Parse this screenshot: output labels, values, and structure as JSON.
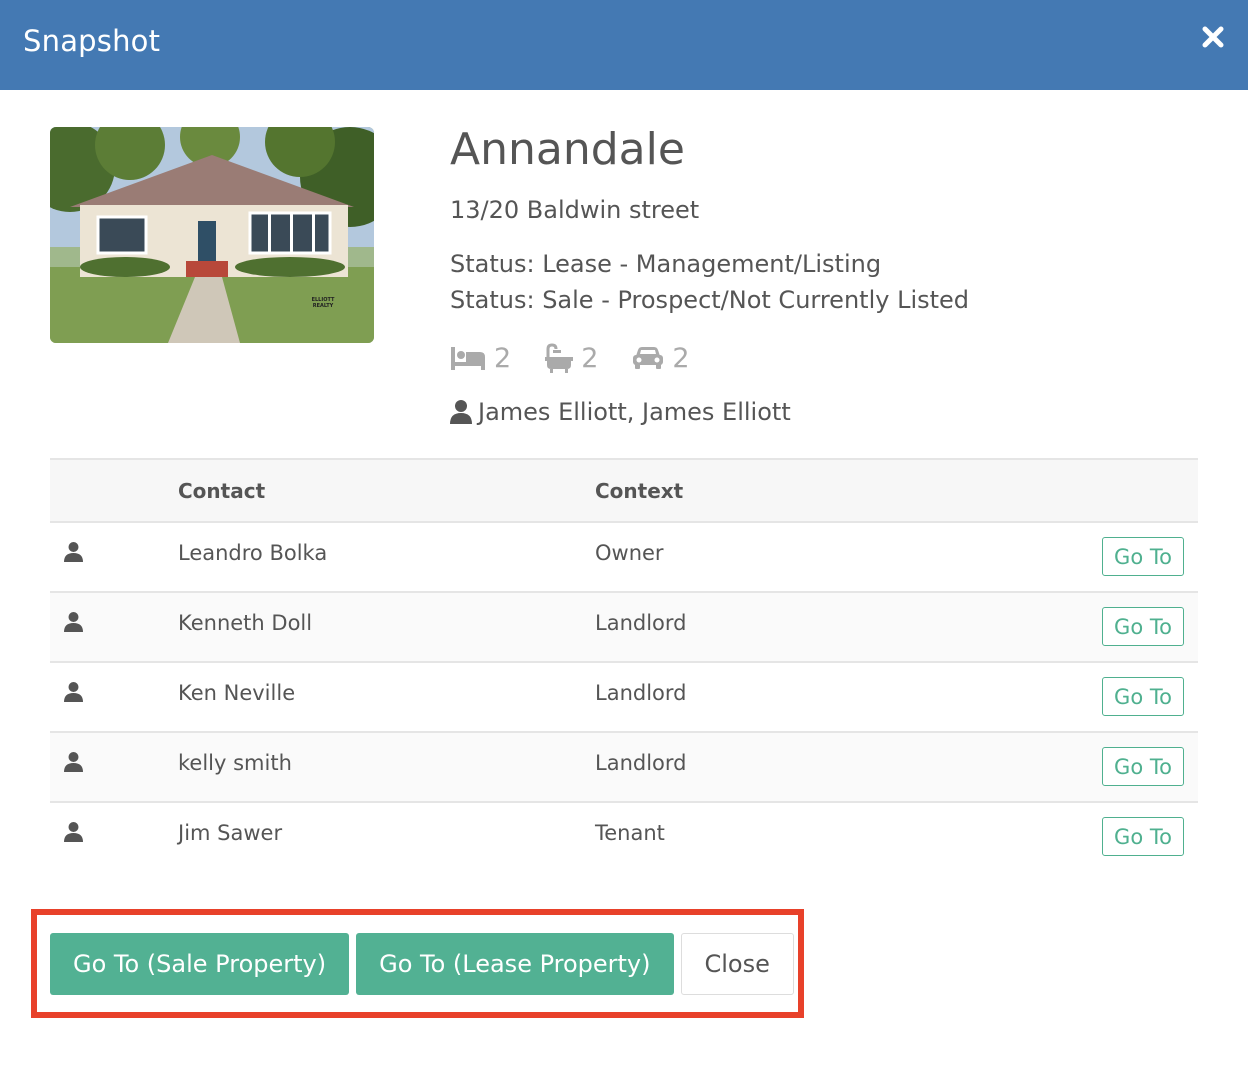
{
  "modal": {
    "title": "Snapshot",
    "close_icon": "close-x-icon"
  },
  "colors": {
    "header": "#4479b3",
    "accent": "#52b193",
    "outline": "#e8412a"
  },
  "property": {
    "name": "Annandale",
    "address": "13/20 Baldwin street",
    "status_lease": "Status: Lease - Management/Listing",
    "status_sale": "Status: Sale - Prospect/Not Currently Listed",
    "bedrooms": "2",
    "bathrooms": "2",
    "car_spaces": "2",
    "agents": "James Elliott, James Elliott",
    "photo_watermark": "ELLIOTT REALTY"
  },
  "contacts": {
    "headers": [
      "",
      "Contact",
      "Context",
      ""
    ],
    "rows": [
      {
        "name": "Leandro Bolka",
        "context": "Owner",
        "action": "Go To"
      },
      {
        "name": "Kenneth Doll",
        "context": "Landlord",
        "action": "Go To"
      },
      {
        "name": "Ken Neville",
        "context": "Landlord",
        "action": "Go To"
      },
      {
        "name": "kelly smith",
        "context": "Landlord",
        "action": "Go To"
      },
      {
        "name": "Jim Sawer",
        "context": "Tenant",
        "action": "Go To"
      }
    ]
  },
  "footer": {
    "goto_sale": "Go To (Sale Property)",
    "goto_lease": "Go To (Lease Property)",
    "close": "Close"
  }
}
